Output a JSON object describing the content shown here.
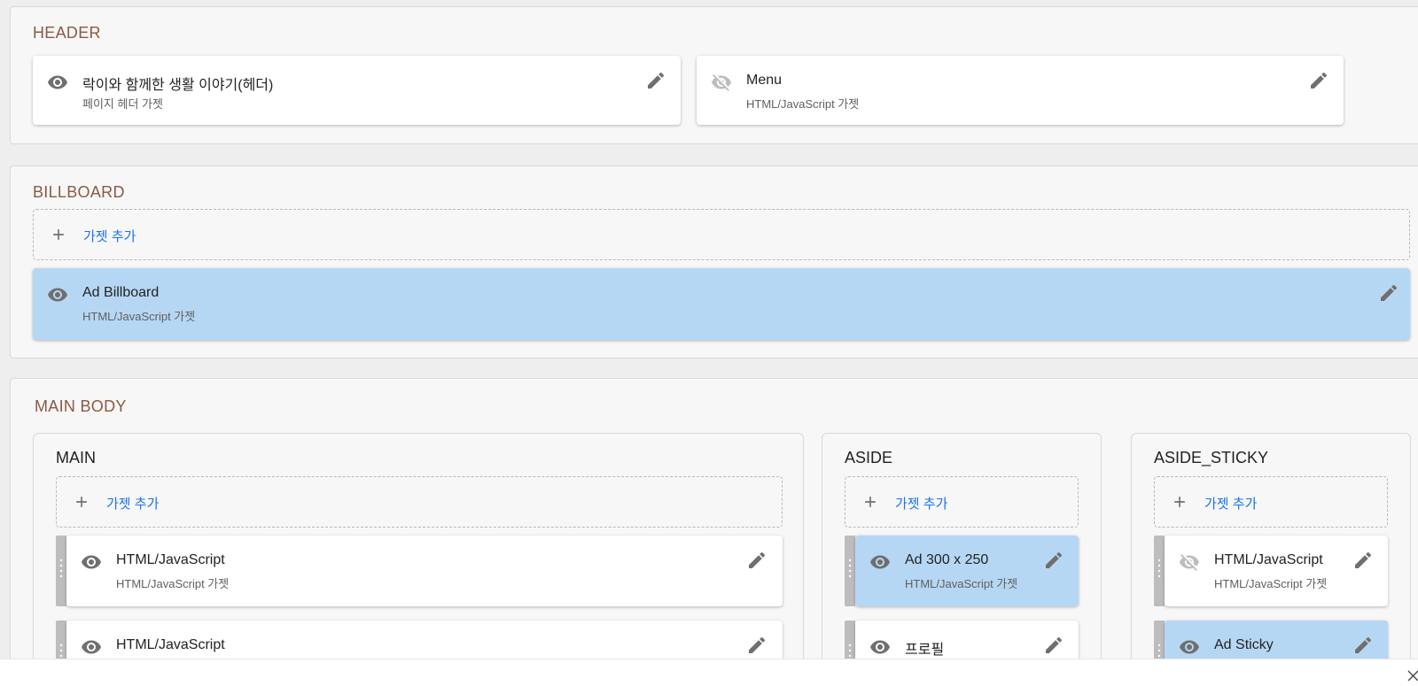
{
  "header_section": {
    "title": "HEADER",
    "gadgets": [
      {
        "title": "락이와 함께한 생활 이야기(헤더)",
        "subtitle": "페이지 헤더 가젯",
        "visible": true
      },
      {
        "title": "Menu",
        "subtitle": "HTML/JavaScript 가젯",
        "visible": false
      }
    ]
  },
  "billboard_section": {
    "title": "BILLBOARD",
    "add_label": "가젯 추가",
    "gadgets": [
      {
        "title": "Ad Billboard",
        "subtitle": "HTML/JavaScript 가젯",
        "visible": true
      }
    ]
  },
  "main_body": {
    "title": "MAIN BODY",
    "columns": [
      {
        "title": "MAIN",
        "add_label": "가젯 추가",
        "gadgets": [
          {
            "title": "HTML/JavaScript",
            "subtitle": "HTML/JavaScript 가젯",
            "visible": true
          },
          {
            "title": "HTML/JavaScript",
            "visible": true
          }
        ]
      },
      {
        "title": "ASIDE",
        "add_label": "가젯 추가",
        "gadgets": [
          {
            "title": "Ad 300 x 250",
            "subtitle": "HTML/JavaScript 가젯",
            "visible": true
          },
          {
            "title": "프로필",
            "visible": true
          }
        ]
      },
      {
        "title": "ASIDE_STICKY",
        "add_label": "가젯 추가",
        "gadgets": [
          {
            "title": "HTML/JavaScript",
            "subtitle": "HTML/JavaScript 가젯",
            "visible": false
          },
          {
            "title": "Ad Sticky",
            "visible": true
          }
        ]
      }
    ]
  },
  "colors": {
    "section_title": "#8a5a44",
    "highlight_card": "#b6d7f3",
    "link": "#1a73e8",
    "icon": "#6f6f6f"
  },
  "icons": {
    "visible": "eye-icon",
    "hidden": "eye-off-icon",
    "edit": "pencil-icon",
    "add": "plus-icon",
    "drag": "drag-handle-icon",
    "close": "close-icon"
  }
}
